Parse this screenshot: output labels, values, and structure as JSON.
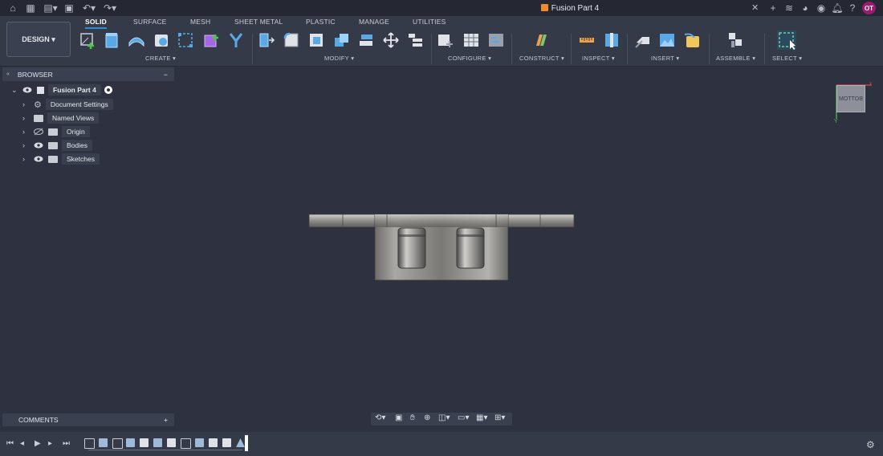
{
  "document": {
    "title": "Fusion Part 4"
  },
  "user": {
    "initials": "OT"
  },
  "workspace": {
    "label": "DESIGN"
  },
  "tabs": [
    {
      "label": "SOLID"
    },
    {
      "label": "SURFACE"
    },
    {
      "label": "MESH"
    },
    {
      "label": "SHEET METAL"
    },
    {
      "label": "PLASTIC"
    },
    {
      "label": "MANAGE"
    },
    {
      "label": "UTILITIES"
    }
  ],
  "groups": {
    "create": "CREATE",
    "modify": "MODIFY",
    "configure": "CONFIGURE",
    "construct": "CONSTRUCT",
    "inspect": "INSPECT",
    "insert": "INSERT",
    "assemble": "ASSEMBLE",
    "select": "SELECT"
  },
  "browser": {
    "title": "BROWSER",
    "root": "Fusion Part 4",
    "items": [
      {
        "label": "Document Settings"
      },
      {
        "label": "Named Views"
      },
      {
        "label": "Origin"
      },
      {
        "label": "Bodies"
      },
      {
        "label": "Sketches"
      }
    ]
  },
  "comments": {
    "title": "COMMENTS"
  },
  "viewcube": {
    "face": "BOTTOM"
  },
  "colors": {
    "accent": "#2d8ed7",
    "avatar": "#9c1a6f",
    "doc_icon": "#f08a2c"
  }
}
